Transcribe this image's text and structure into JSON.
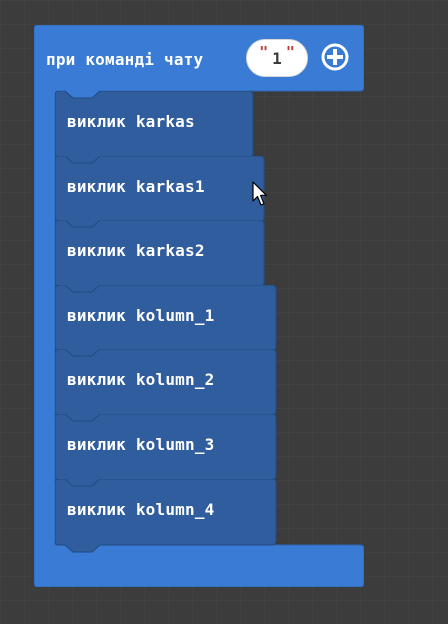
{
  "event": {
    "label": "при команді чату",
    "command_value": "1",
    "add_button_icon": "plus-circle-icon",
    "color": "#3a7bd5"
  },
  "call_blocks": [
    {
      "label": "виклик karkas"
    },
    {
      "label": "виклик karkas1"
    },
    {
      "label": "виклик karkas2"
    },
    {
      "label": "виклик kolumn_1"
    },
    {
      "label": "виклик kolumn_2"
    },
    {
      "label": "виклик kolumn_3"
    },
    {
      "label": "виклик kolumn_4"
    }
  ],
  "colors": {
    "background": "#3c3c3c",
    "event_block": "#3a7bd5",
    "call_block": "#305d9e",
    "call_block_stroke": "#1f4a82",
    "text": "#ffffff"
  }
}
